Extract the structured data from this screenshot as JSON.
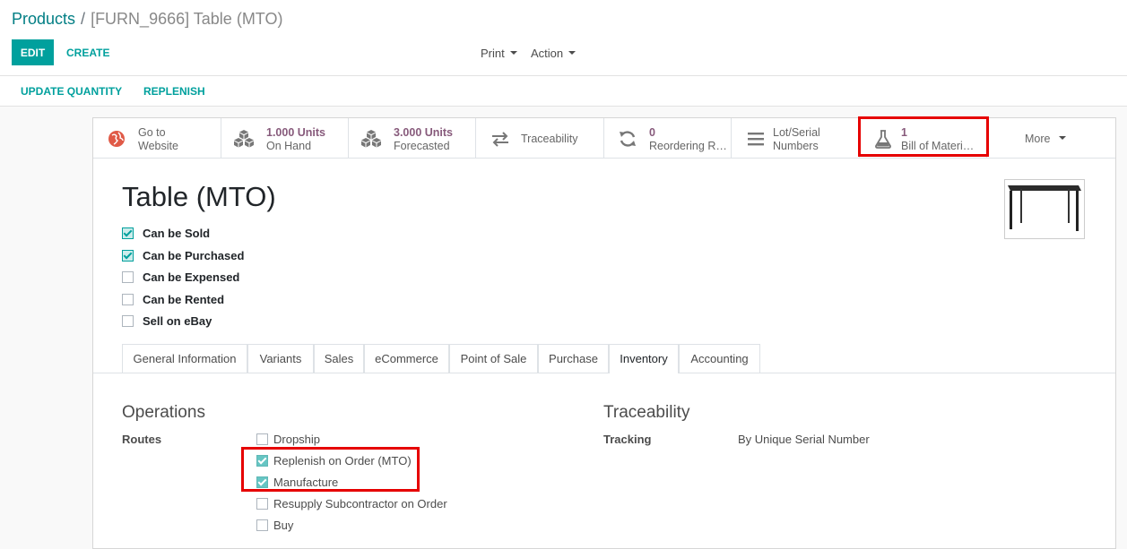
{
  "breadcrumb": {
    "parent": "Products",
    "separator": "/",
    "current": "[FURN_9666] Table (MTO)"
  },
  "toolbar": {
    "edit_label": "EDIT",
    "create_label": "CREATE",
    "print_label": "Print",
    "action_label": "Action"
  },
  "header_buttons": {
    "update_quantity": "UPDATE QUANTITY",
    "replenish": "REPLENISH"
  },
  "stat_buttons": {
    "website": {
      "line1": "Go to",
      "line2": "Website",
      "icon": "globe-icon"
    },
    "on_hand": {
      "line1": "1.000 Units",
      "line2": "On Hand",
      "icon": "cubes-icon"
    },
    "forecasted": {
      "line1": "3.000 Units",
      "line2": "Forecasted",
      "icon": "cubes-icon"
    },
    "traceability": {
      "label": "Traceability",
      "icon": "exchange-arrows-icon"
    },
    "reordering": {
      "line1": "0",
      "line2": "Reordering R…",
      "icon": "refresh-icon"
    },
    "lots": {
      "line1": "Lot/Serial",
      "line2": "Numbers",
      "icon": "bars-icon"
    },
    "bom": {
      "line1": "1",
      "line2": "Bill of Materi…",
      "icon": "flask-icon"
    },
    "more": {
      "label": "More"
    }
  },
  "product": {
    "name": "Table (MTO)",
    "flags": [
      {
        "label": "Can be Sold",
        "checked": true
      },
      {
        "label": "Can be Purchased",
        "checked": true
      },
      {
        "label": "Can be Expensed",
        "checked": false
      },
      {
        "label": "Can be Rented",
        "checked": false
      },
      {
        "label": "Sell on eBay",
        "checked": false
      }
    ]
  },
  "tabs": [
    "General Information",
    "Variants",
    "Sales",
    "eCommerce",
    "Point of Sale",
    "Purchase",
    "Inventory",
    "Accounting"
  ],
  "active_tab": "Inventory",
  "operations": {
    "title": "Operations",
    "routes_label": "Routes",
    "routes": [
      {
        "label": "Dropship",
        "checked": false
      },
      {
        "label": "Replenish on Order (MTO)",
        "checked": true
      },
      {
        "label": "Manufacture",
        "checked": true
      },
      {
        "label": "Resupply Subcontractor on Order",
        "checked": false
      },
      {
        "label": "Buy",
        "checked": false
      }
    ]
  },
  "traceability_section": {
    "title": "Traceability",
    "tracking_label": "Tracking",
    "tracking_value": "By Unique Serial Number"
  },
  "colors": {
    "primary": "#00a09d",
    "link": "#017e84",
    "stat_number": "#875a7b",
    "highlight": "#e60000"
  }
}
